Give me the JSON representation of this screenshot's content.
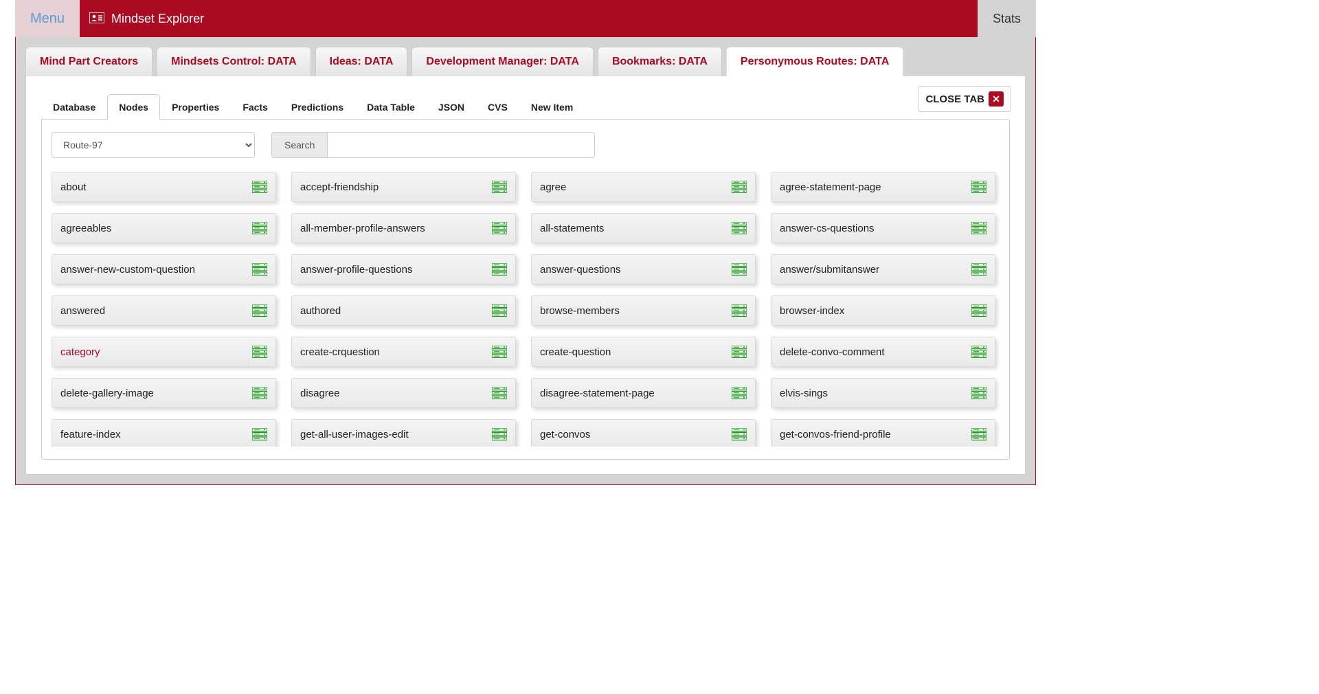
{
  "header": {
    "menu_label": "Menu",
    "app_title": "Mindset Explorer",
    "stats_label": "Stats"
  },
  "main_tabs": [
    {
      "label": "Mind Part Creators",
      "active": false
    },
    {
      "label": "Mindsets Control: DATA",
      "active": false
    },
    {
      "label": "Ideas: DATA",
      "active": false
    },
    {
      "label": "Development Manager: DATA",
      "active": false
    },
    {
      "label": "Bookmarks: DATA",
      "active": false
    },
    {
      "label": "Personymous Routes: DATA",
      "active": true
    }
  ],
  "close_tab_label": "CLOSE TAB",
  "sub_tabs": [
    {
      "label": "Database",
      "active": false
    },
    {
      "label": "Nodes",
      "active": true
    },
    {
      "label": "Properties",
      "active": false
    },
    {
      "label": "Facts",
      "active": false
    },
    {
      "label": "Predictions",
      "active": false
    },
    {
      "label": "Data Table",
      "active": false
    },
    {
      "label": "JSON",
      "active": false
    },
    {
      "label": "CVS",
      "active": false
    },
    {
      "label": "New Item",
      "active": false
    }
  ],
  "controls": {
    "route_selected": "Route-97",
    "search_label": "Search",
    "search_value": ""
  },
  "nodes": [
    {
      "label": "about",
      "special": false
    },
    {
      "label": "accept-friendship",
      "special": false
    },
    {
      "label": "agree",
      "special": false
    },
    {
      "label": "agree-statement-page",
      "special": false
    },
    {
      "label": "agreeables",
      "special": false
    },
    {
      "label": "all-member-profile-answers",
      "special": false
    },
    {
      "label": "all-statements",
      "special": false
    },
    {
      "label": "answer-cs-questions",
      "special": false
    },
    {
      "label": "answer-new-custom-question",
      "special": false
    },
    {
      "label": "answer-profile-questions",
      "special": false
    },
    {
      "label": "answer-questions",
      "special": false
    },
    {
      "label": "answer/submitanswer",
      "special": false
    },
    {
      "label": "answered",
      "special": false
    },
    {
      "label": "authored",
      "special": false
    },
    {
      "label": "browse-members",
      "special": false
    },
    {
      "label": "browser-index",
      "special": false
    },
    {
      "label": "category",
      "special": true
    },
    {
      "label": "create-crquestion",
      "special": false
    },
    {
      "label": "create-question",
      "special": false
    },
    {
      "label": "delete-convo-comment",
      "special": false
    },
    {
      "label": "delete-gallery-image",
      "special": false
    },
    {
      "label": "disagree",
      "special": false
    },
    {
      "label": "disagree-statement-page",
      "special": false
    },
    {
      "label": "elvis-sings",
      "special": false
    },
    {
      "label": "feature-index",
      "special": false
    },
    {
      "label": "get-all-user-images-edit",
      "special": false
    },
    {
      "label": "get-convos",
      "special": false
    },
    {
      "label": "get-convos-friend-profile",
      "special": false
    }
  ],
  "icons": {
    "server_icon_color": "#1a9e1a"
  }
}
